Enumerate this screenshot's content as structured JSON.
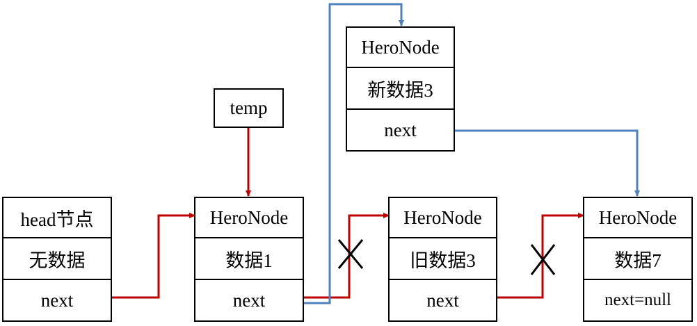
{
  "colors": {
    "red": "#c00000",
    "blue": "#4f81bd",
    "black": "#000000"
  },
  "temp": {
    "label": "temp"
  },
  "nodes": {
    "head": {
      "title": "head节点",
      "data": "无数据",
      "next": "next"
    },
    "node1": {
      "title": "HeroNode",
      "data": "数据1",
      "next": "next"
    },
    "node3_new": {
      "title": "HeroNode",
      "data": "新数据3",
      "next": "next"
    },
    "node3_old": {
      "title": "HeroNode",
      "data": "旧数据3",
      "next": "next"
    },
    "node7": {
      "title": "HeroNode",
      "data": "数据7",
      "next": "next=null"
    }
  }
}
